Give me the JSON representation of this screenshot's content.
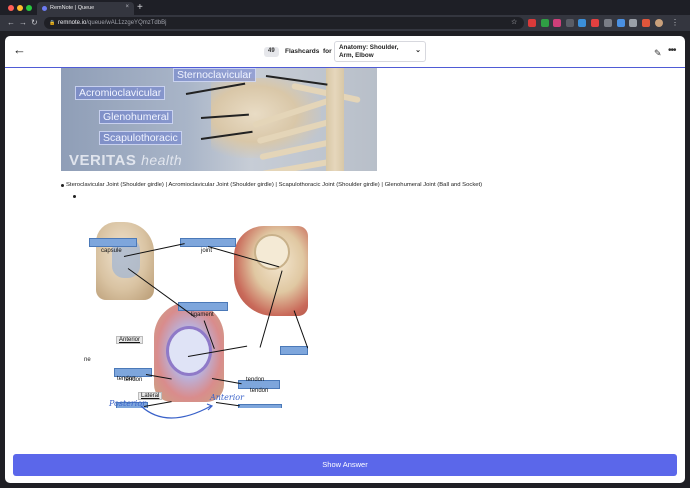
{
  "browser": {
    "tab_title": "RemNote | Queue",
    "tab_close": "×",
    "new_tab": "+",
    "url_host": "remnote.io",
    "url_path": "/queue/wAL1zzgeYQmzTdbBj",
    "traffic_colors": [
      "#ff5f57",
      "#febc2e",
      "#28c840"
    ]
  },
  "header": {
    "back_icon": "←",
    "card_count": "49",
    "flashcards_label": "Flashcards",
    "for_label": "for",
    "deck_name": "Anatomy: Shoulder, Arm, Elbow",
    "chevron": "⌄",
    "edit_icon": "✎",
    "more_icon": "•••"
  },
  "image": {
    "labels": [
      "Sternoclavicular",
      "Acromioclavicular",
      "Glenohumeral",
      "Scapulothoracic"
    ],
    "watermark_brand": "VERITAS",
    "watermark_suffix": "health"
  },
  "bullets": {
    "answer_text": "Steroclavicular Joint (Shoulder girdle) | Acromioclavicular Joint (Shoulder girdle) | Scapulothoracic Joint (Shoulder girdle) | Glenohumeral Joint (Ball and Socket)"
  },
  "diagram": {
    "capsule": "capsule",
    "joint": "joint",
    "ligament": "ligament",
    "anterior_box": "Anterior",
    "lateral_box": "Lateral",
    "tendon": "tendon",
    "side_text": "ne",
    "posterior_hand": "Posterior",
    "anterior_hand": "Anterior"
  },
  "footer": {
    "show_answer": "Show Answer"
  },
  "colors": {
    "accent": "#5b67ea",
    "blank_fill": "#7ea6dc"
  }
}
